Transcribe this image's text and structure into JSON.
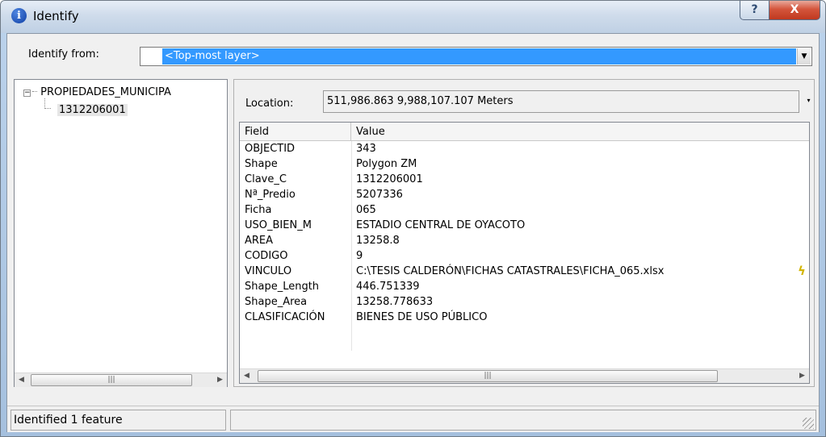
{
  "window": {
    "title": "Identify",
    "help_label": "?",
    "close_label": "X"
  },
  "identify_from": {
    "label": "Identify from:",
    "selected": "<Top-most layer>"
  },
  "tree": {
    "root_label": "PROPIEDADES_MUNICIPA",
    "child_label": "1312206001"
  },
  "location": {
    "label": "Location:",
    "value": "511,986.863  9,988,107.107 Meters"
  },
  "grid": {
    "columns": [
      "Field",
      "Value"
    ],
    "rows": [
      {
        "field": "OBJECTID",
        "value": "343"
      },
      {
        "field": "Shape",
        "value": "Polygon ZM"
      },
      {
        "field": "Clave_C",
        "value": "1312206001"
      },
      {
        "field": "Nª_Predio",
        "value": "5207336"
      },
      {
        "field": "Ficha",
        "value": "065"
      },
      {
        "field": "USO_BIEN_M",
        "value": "ESTADIO CENTRAL DE OYACOTO"
      },
      {
        "field": "AREA",
        "value": "13258.8"
      },
      {
        "field": "CODIGO",
        "value": "9"
      },
      {
        "field": "VINCULO",
        "value": "C:\\TESIS CALDERÓN\\FICHAS CATASTRALES\\FICHA_065.xlsx"
      },
      {
        "field": "Shape_Length",
        "value": "446.751339"
      },
      {
        "field": "Shape_Area",
        "value": "13258.778633"
      },
      {
        "field": "CLASIFICACIÓN",
        "value": "BIENES DE USO PÚBLICO"
      }
    ]
  },
  "status": {
    "text": "Identified 1 feature"
  },
  "icons": {
    "title": "info-icon",
    "hyperlink": "lightning-icon"
  }
}
